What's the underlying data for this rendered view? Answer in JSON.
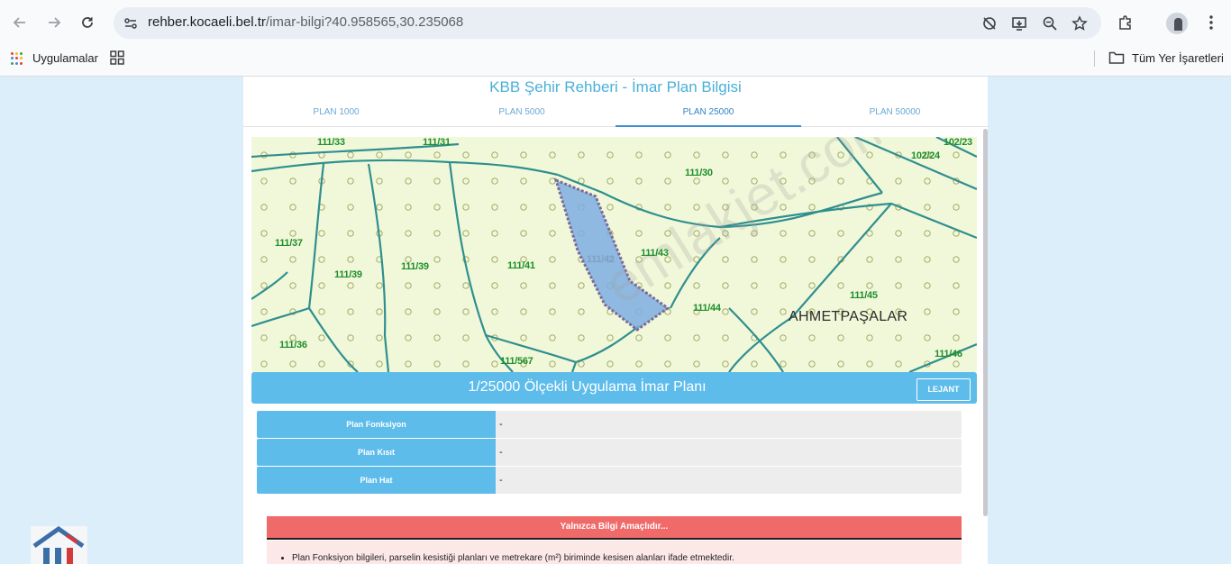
{
  "browser": {
    "url_host": "rehber.kocaeli.bel.tr",
    "url_path": "/imar-bilgi?40.958565,30.235068",
    "bookmarks": {
      "apps_label": "Uygulamalar",
      "all_bookmarks_label": "Tüm Yer İşaretleri"
    }
  },
  "page": {
    "title": "KBB Şehir Rehberi - İmar Plan Bilgisi",
    "tabs": [
      {
        "label": "PLAN 1000",
        "active": false
      },
      {
        "label": "PLAN 5000",
        "active": false
      },
      {
        "label": "PLAN 25000",
        "active": true
      },
      {
        "label": "PLAN 50000",
        "active": false
      }
    ],
    "map": {
      "parcels": [
        "111/33",
        "111/31",
        "102/23",
        "102/24",
        "111/30",
        "111/37",
        "111/39",
        "111/39",
        "111/41",
        "111/43",
        "111/45",
        "111/44",
        "111/36",
        "111/567",
        "111/46",
        "111/42"
      ],
      "locality": "AHMETPAŞALAR",
      "watermark": "emlakjet.com"
    },
    "plan_header": {
      "title": "1/25000 Ölçekli Uygulama İmar Planı",
      "legend_button": "LEJANT"
    },
    "info_rows": [
      {
        "label": "Plan Fonksiyon",
        "value": "-"
      },
      {
        "label": "Plan Kısıt",
        "value": "-"
      },
      {
        "label": "Plan Hat",
        "value": "-"
      }
    ],
    "notice": {
      "title": "Yalnızca Bilgi Amaçlıdır...",
      "item": "Plan Fonksiyon bilgileri, parselin kesistiği planları ve metrekare (m²) biriminde kesisen alanları ifade etmektedir."
    }
  }
}
